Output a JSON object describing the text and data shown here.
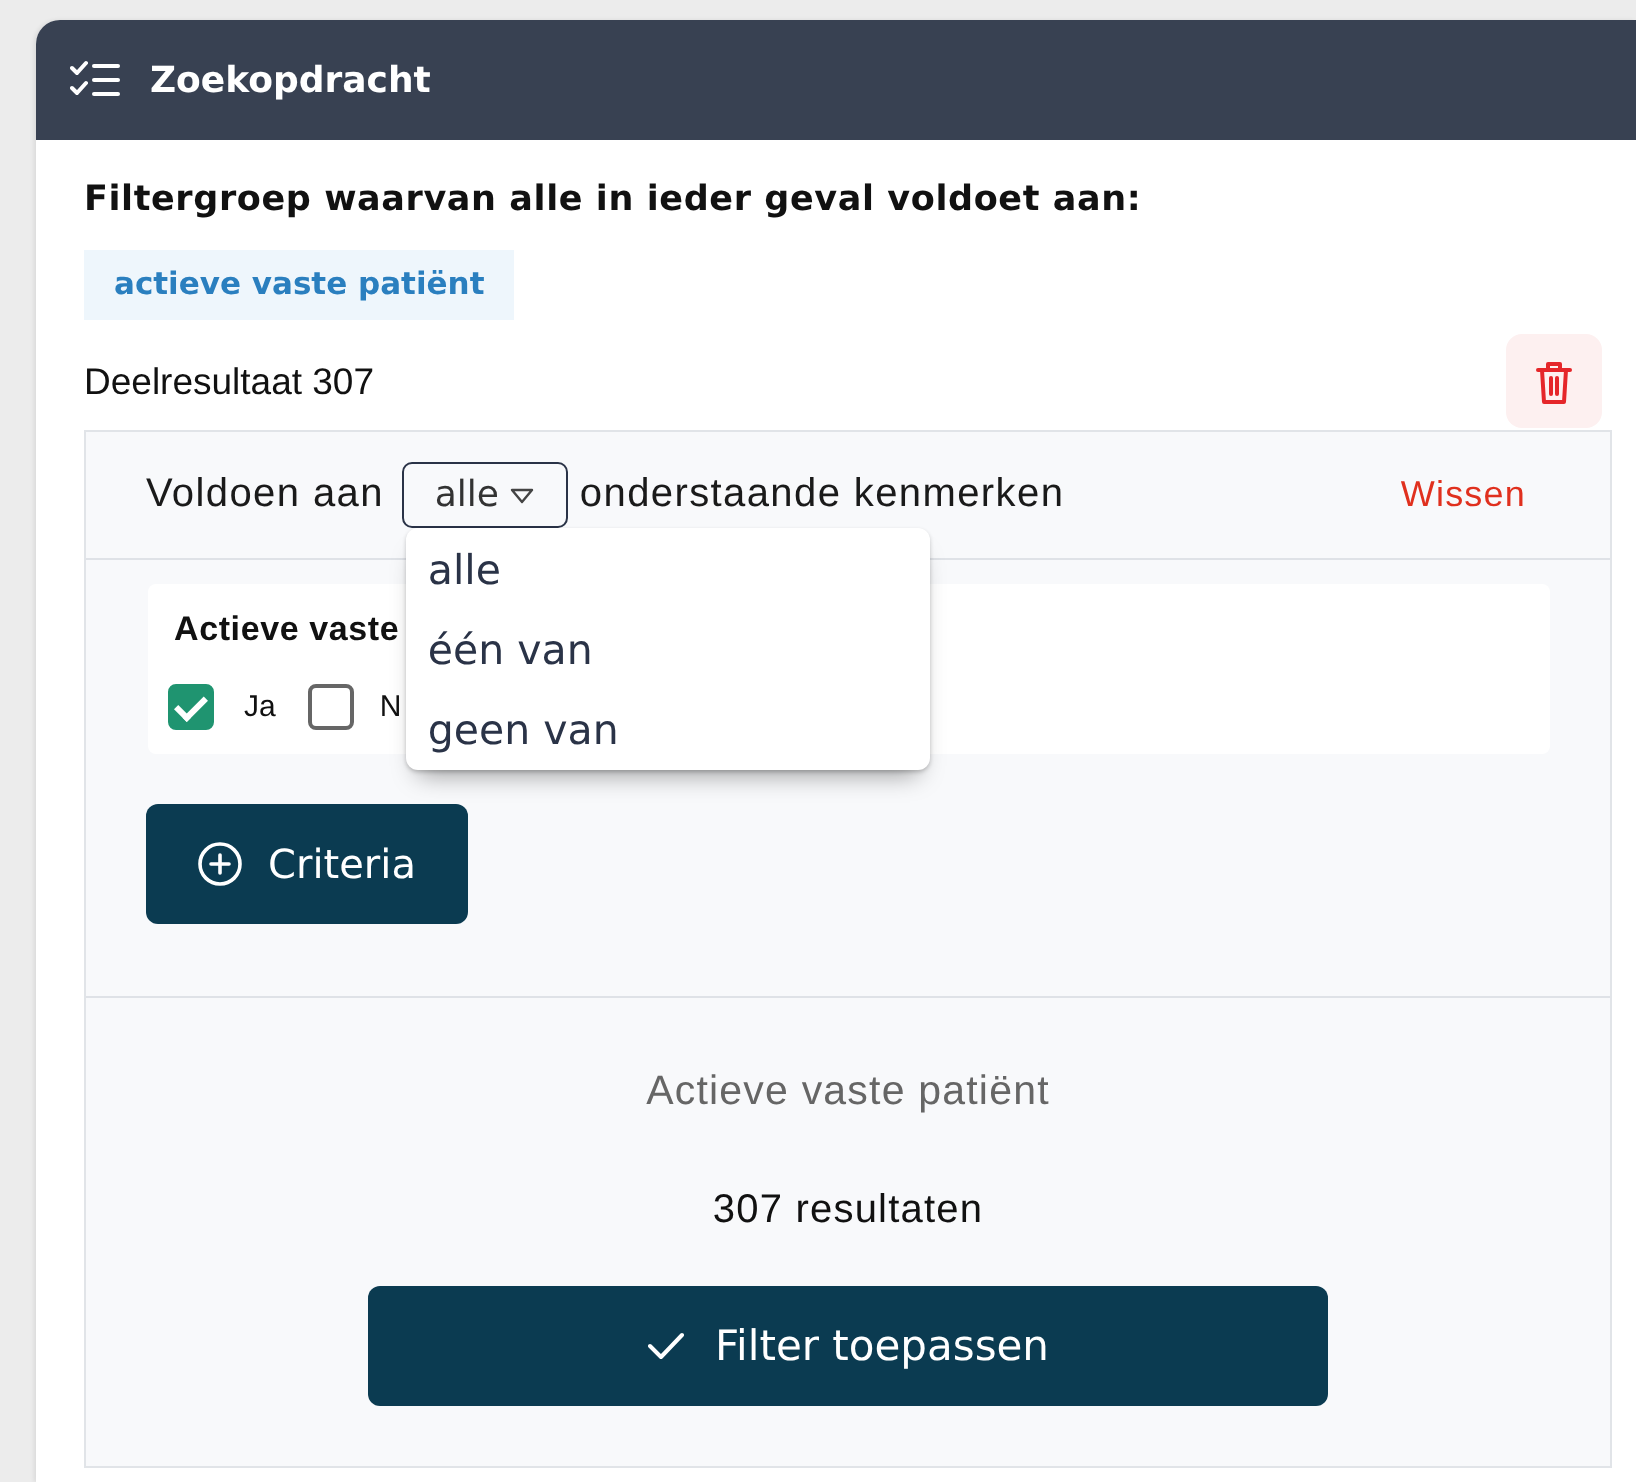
{
  "window": {
    "title": "Zoekopdracht"
  },
  "filter_group": {
    "heading": "Filtergroep waarvan alle in ieder geval voldoet aan:",
    "tags": [
      "actieve vaste patiënt"
    ],
    "partial_result": "Deelresultaat 307"
  },
  "criteria_group": {
    "match_prefix": "Voldoen aan",
    "match_select": {
      "value": "alle",
      "expanded": true,
      "options": [
        "alle",
        "één van",
        "geen van"
      ]
    },
    "match_suffix": "onderstaande kenmerken",
    "clear_link": "Wissen",
    "criteria": [
      {
        "title": "Actieve vaste",
        "options": [
          {
            "label": "Ja",
            "checked": true
          },
          {
            "label": "N",
            "checked": false
          }
        ]
      }
    ],
    "add_button": "Criteria"
  },
  "summary": {
    "title": "Actieve vaste patiënt",
    "result_count": "307 resultaten",
    "apply_button": "Filter toepassen"
  }
}
